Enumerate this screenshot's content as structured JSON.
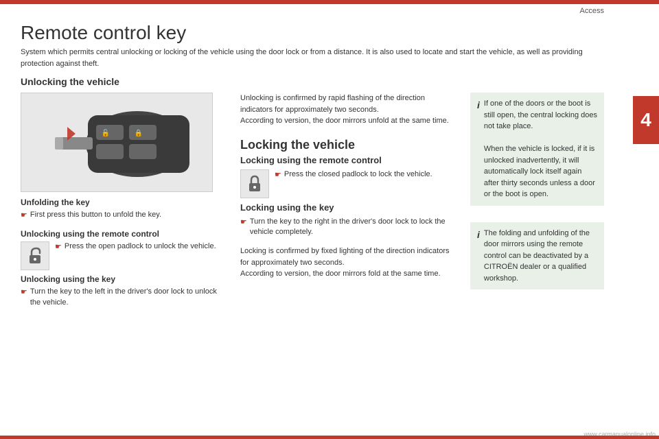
{
  "header": {
    "section_label": "Access"
  },
  "side_tab": {
    "number": "4"
  },
  "page": {
    "title": "Remote control key",
    "subtitle": "System which permits central unlocking or locking of the vehicle using the door lock or from a distance. It is also used to locate and start the vehicle, as well as providing protection against theft."
  },
  "unlocking_section": {
    "heading": "Unlocking the vehicle",
    "unfolding_key": {
      "heading": "Unfolding the key",
      "arrow_text": "First press this button to unfold the key."
    },
    "unlocking_remote": {
      "heading": "Unlocking using the remote control",
      "arrow_text": "Press the open padlock to unlock the vehicle."
    },
    "unlocking_key": {
      "heading": "Unlocking using the key",
      "arrow_text": "Turn the key to the left in the driver's door lock to unlock the vehicle."
    }
  },
  "mid_column": {
    "unlocking_confirmed": "Unlocking is confirmed by rapid flashing of the direction indicators for approximately two seconds.\nAccording to version, the door mirrors unfold at the same time.",
    "locking_heading": "Locking the vehicle",
    "locking_remote_heading": "Locking using the remote control",
    "locking_remote_arrow": "Press the closed padlock to lock the vehicle.",
    "locking_key_heading": "Locking using the key",
    "locking_key_arrow": "Turn the key to the right in the driver's door lock to lock the vehicle completely.",
    "locking_confirmed": "Locking is confirmed by fixed lighting of the direction indicators for approximately two seconds.\nAccording to version, the door mirrors fold at the same time."
  },
  "info_boxes": {
    "box1": {
      "letter": "i",
      "text": "If one of the doors or the boot is still open, the central locking does not take place.\nWhen the vehicle is locked, if it is unlocked inadvertently, it will automatically lock itself again after thirty seconds unless a door or the boot is open."
    },
    "box2": {
      "letter": "i",
      "text": "The folding and unfolding of the door mirrors using the remote control can be deactivated by a CITROËN dealer or a qualified workshop."
    }
  },
  "watermark": "www.carmanualonline.info"
}
